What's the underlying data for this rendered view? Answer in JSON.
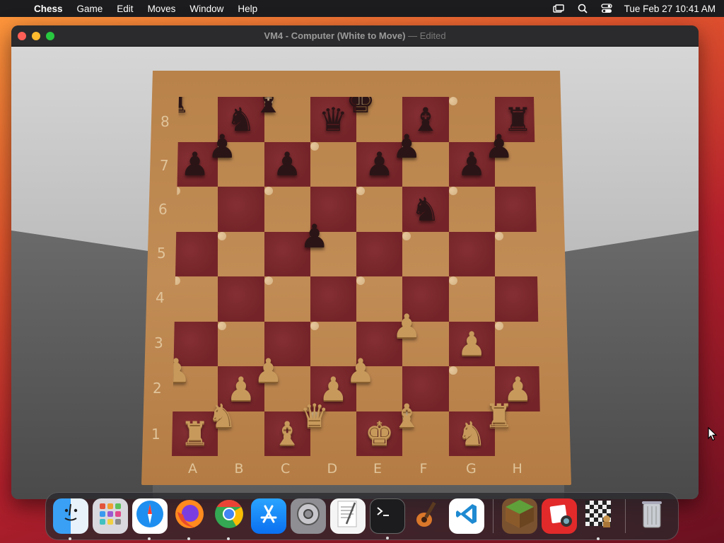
{
  "menubar": {
    "app_name": "Chess",
    "menus": [
      "Game",
      "Edit",
      "Moves",
      "Window",
      "Help"
    ],
    "datetime": "Tue Feb 27  10:41 AM",
    "status_icons": [
      "screen-mirror-icon",
      "search-icon",
      "control-center-icon"
    ]
  },
  "window": {
    "title": "VM4 - Computer   (White to Move)",
    "edited": "— Edited"
  },
  "board": {
    "ranks": [
      "8",
      "7",
      "6",
      "5",
      "4",
      "3",
      "2",
      "1"
    ],
    "files": [
      "A",
      "B",
      "C",
      "D",
      "E",
      "F",
      "G",
      "H"
    ],
    "position": [
      [
        "bR",
        "bN",
        "bB",
        "bQ",
        "bK",
        "bB",
        "",
        "bR"
      ],
      [
        "bP",
        "bP",
        "bP",
        "",
        "bP",
        "bP",
        "bP",
        "bP"
      ],
      [
        "",
        "",
        "",
        "",
        "",
        "bN",
        "",
        ""
      ],
      [
        "",
        "",
        "",
        "bP",
        "",
        "",
        "",
        ""
      ],
      [
        "",
        "",
        "",
        "",
        "",
        "",
        "",
        ""
      ],
      [
        "",
        "",
        "",
        "",
        "",
        "wP",
        "wP",
        ""
      ],
      [
        "wP",
        "wP",
        "wP",
        "wP",
        "wP",
        "",
        "",
        "wP"
      ],
      [
        "wR",
        "wN",
        "wB",
        "wQ",
        "wK",
        "wB",
        "wN",
        "wR"
      ]
    ],
    "colors": {
      "light_square": "#d9b88a",
      "dark_square": "#742428",
      "frame": "#bf8950"
    }
  },
  "dock": {
    "apps": [
      {
        "name": "finder-icon",
        "running": true
      },
      {
        "name": "launchpad-icon",
        "running": false
      },
      {
        "name": "safari-icon",
        "running": true
      },
      {
        "name": "firefox-icon",
        "running": true
      },
      {
        "name": "chrome-icon",
        "running": true
      },
      {
        "name": "app-store-icon",
        "running": false
      },
      {
        "name": "system-settings-icon",
        "running": false
      },
      {
        "name": "textedit-icon",
        "running": false
      },
      {
        "name": "terminal-icon",
        "running": true
      },
      {
        "name": "garageband-icon",
        "running": false
      },
      {
        "name": "vscode-icon",
        "running": false
      }
    ],
    "recent": [
      {
        "name": "minecraft-icon",
        "running": false
      },
      {
        "name": "photo-booth-icon",
        "running": false
      },
      {
        "name": "chess-icon",
        "running": true
      }
    ],
    "trash": {
      "name": "trash-icon"
    }
  }
}
